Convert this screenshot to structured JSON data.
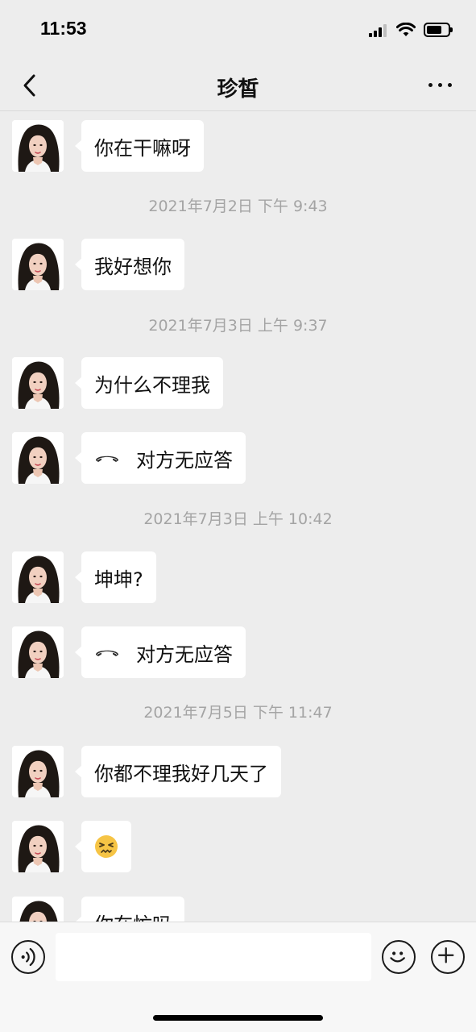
{
  "status_bar": {
    "time": "11:53"
  },
  "header": {
    "title": "珍皙"
  },
  "messages": [
    {
      "type": "text",
      "text": "你在干嘛呀"
    },
    {
      "type": "time",
      "text": "2021年7月2日 下午 9:43"
    },
    {
      "type": "text",
      "text": "我好想你"
    },
    {
      "type": "time",
      "text": "2021年7月3日 上午 9:37"
    },
    {
      "type": "text",
      "text": "为什么不理我"
    },
    {
      "type": "call",
      "text": "对方无应答",
      "icon": "phone-hangup-icon"
    },
    {
      "type": "time",
      "text": "2021年7月3日 上午 10:42"
    },
    {
      "type": "text",
      "text": "坤坤?"
    },
    {
      "type": "call",
      "text": "对方无应答",
      "icon": "phone-hangup-icon"
    },
    {
      "type": "time",
      "text": "2021年7月5日 下午 11:47"
    },
    {
      "type": "text",
      "text": "你都不理我好几天了"
    },
    {
      "type": "emoji",
      "emoji": "😣",
      "icon": "persevering-face-emoji"
    },
    {
      "type": "text",
      "text": "你在忙吗"
    }
  ],
  "input": {
    "value": "",
    "placeholder": ""
  },
  "icons": {
    "back": "chevron-left-icon",
    "more": "more-dots-icon",
    "voice": "voice-icon",
    "emoji": "smiley-icon",
    "plus": "plus-icon"
  },
  "colors": {
    "background": "#ededed",
    "bubble": "#ffffff",
    "timestamp": "#a4a4a4"
  }
}
